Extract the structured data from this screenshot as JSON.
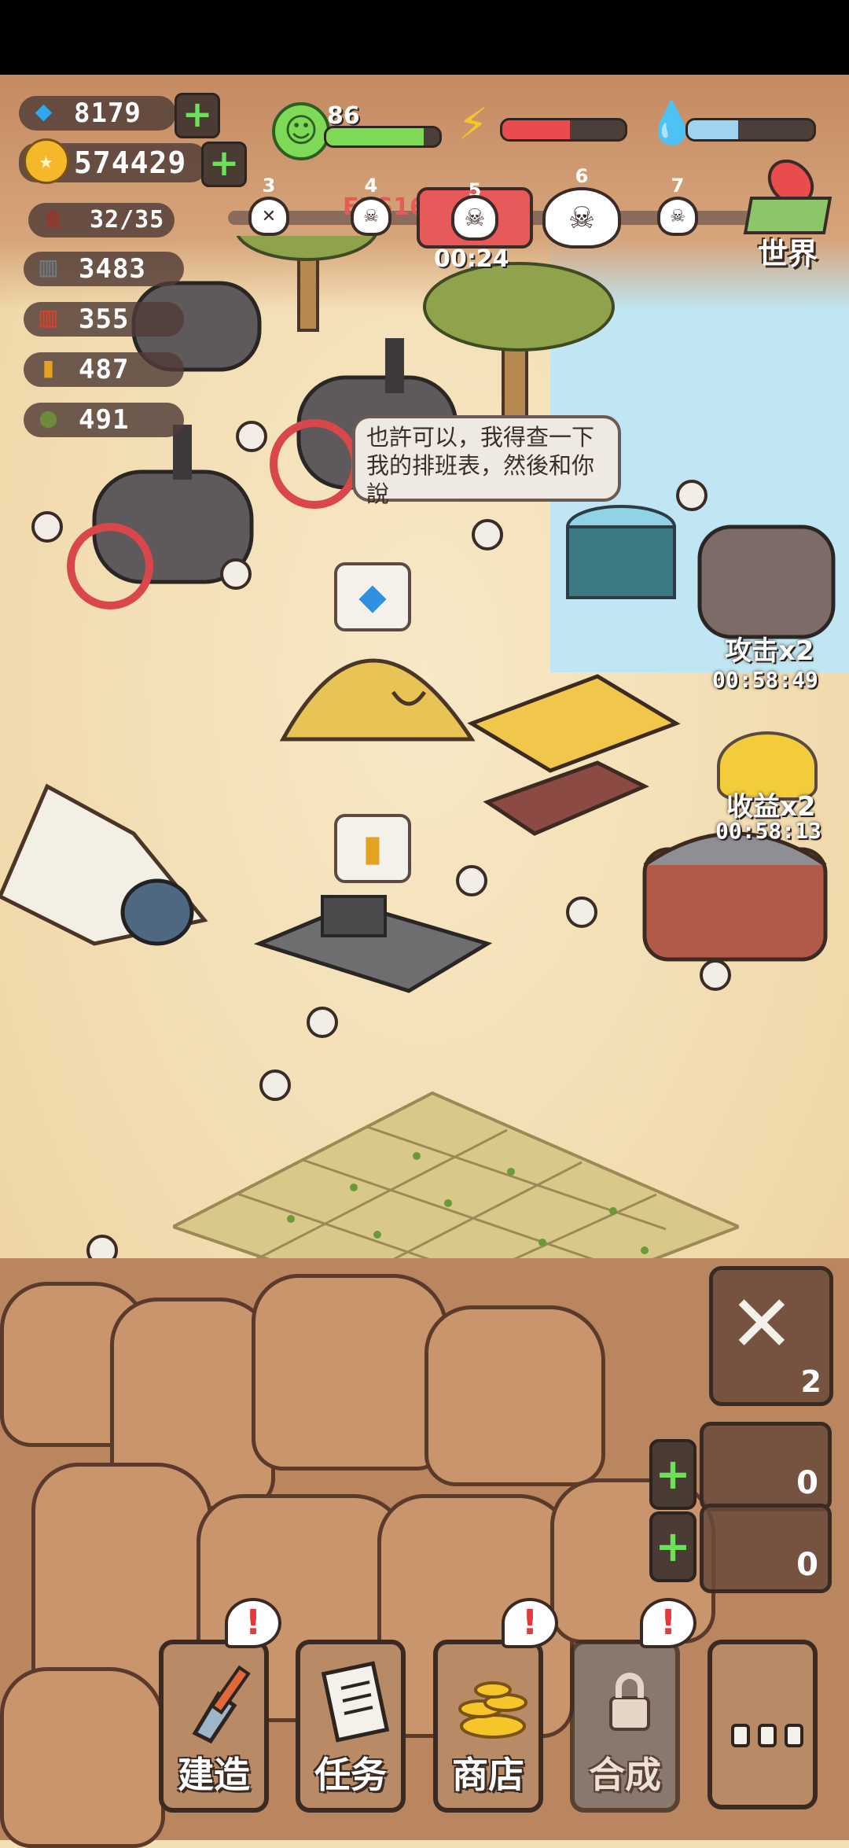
{
  "resources": {
    "gems": "8179",
    "coins": "574429",
    "population": "32/35",
    "ammo_clips": "3483",
    "shells": "355",
    "bullets": "487",
    "bombs": "491"
  },
  "status": {
    "happiness": "86",
    "happiness_level": 0.86,
    "energy_level": 0.55,
    "water_level": 0.4
  },
  "waves": {
    "nodes": [
      "3",
      "4",
      "5",
      "6",
      "7"
    ],
    "current_index": 2,
    "timer": "00:24",
    "fps_overlay": "FPS16"
  },
  "world_button": {
    "label": "世界"
  },
  "speech_bubble": {
    "text": "也許可以，我得查一下我的排班表，然後和你說"
  },
  "boosts": [
    {
      "label": "攻击x2",
      "timer": "00:58:49"
    },
    {
      "label": "收益x2",
      "timer": "00:58:13"
    }
  ],
  "tools": {
    "repair_count": "2",
    "slot1_count": "0",
    "slot2_count": "0"
  },
  "nav": [
    {
      "label": "建造",
      "icon": "shovel-icon",
      "alert": "!"
    },
    {
      "label": "任务",
      "icon": "scroll-icon",
      "alert": ""
    },
    {
      "label": "商店",
      "icon": "coins-icon",
      "alert": "!"
    },
    {
      "label": "合成",
      "icon": "lock-icon",
      "alert": "!"
    },
    {
      "label": "",
      "icon": "more-icon",
      "alert": ""
    }
  ],
  "colors": {
    "health_green": "#7ed957",
    "energy_red": "#e84c4c",
    "water_blue": "#9fd3ef",
    "wave_active": "#e85a5a",
    "plus_green": "#6ee05a"
  }
}
